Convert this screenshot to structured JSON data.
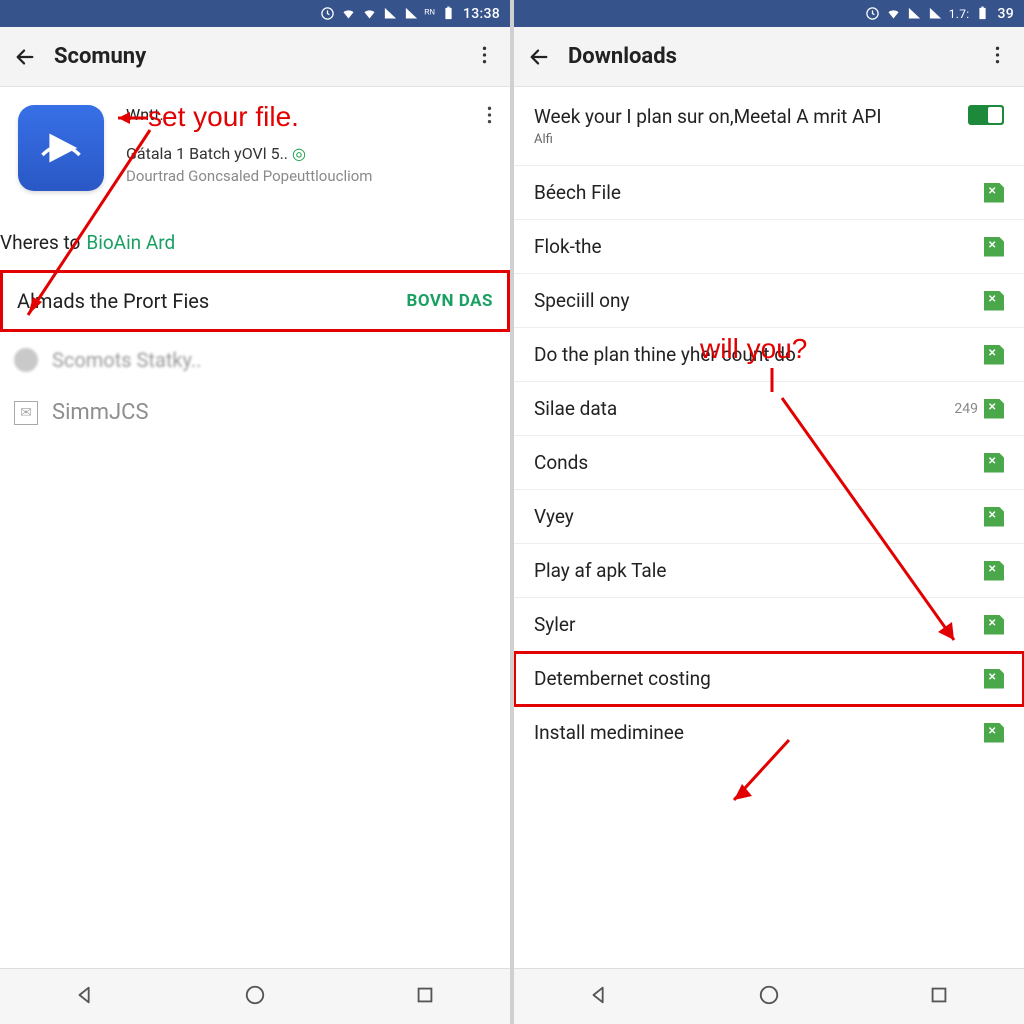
{
  "left": {
    "statusbar": {
      "time": "13:38",
      "battery_text": ""
    },
    "appbar": {
      "title": "Scomuny"
    },
    "app": {
      "line1": "Wntt.",
      "line2_a": "Gátala 1 Batch yOVl 5..",
      "line2_check": "◎",
      "line3": "Dourtrad Goncsaled Popeuttloucliom"
    },
    "section": {
      "label_a": "Vheres to",
      "label_b": "BioAin Ard",
      "boxed_text": "Almads the Prort Fies",
      "boxed_button": "BOVN DAS"
    },
    "rows": {
      "r1": "Scomots        Statky..",
      "r2": "SimmJCS"
    },
    "annotation": "set your file."
  },
  "right": {
    "statusbar": {
      "time": "39",
      "battery_text": "1.7:"
    },
    "appbar": {
      "title": "Downloads"
    },
    "header_row": {
      "label": "Week your I plan sur on,Meetal A mrit API",
      "sub": "Alfi"
    },
    "items": [
      {
        "label": "Béech File"
      },
      {
        "label": "Flok-the"
      },
      {
        "label": "Speciill ony"
      },
      {
        "label": "Do the plan thine yher count do"
      },
      {
        "label": "Silae data",
        "count": "249"
      },
      {
        "label": "Conds"
      },
      {
        "label": "Vyey"
      },
      {
        "label": "Play af apk Tale"
      },
      {
        "label": "Syler"
      },
      {
        "label": "Detembernet costing"
      },
      {
        "label": "Install mediminee"
      }
    ],
    "annotation": "will you?"
  }
}
